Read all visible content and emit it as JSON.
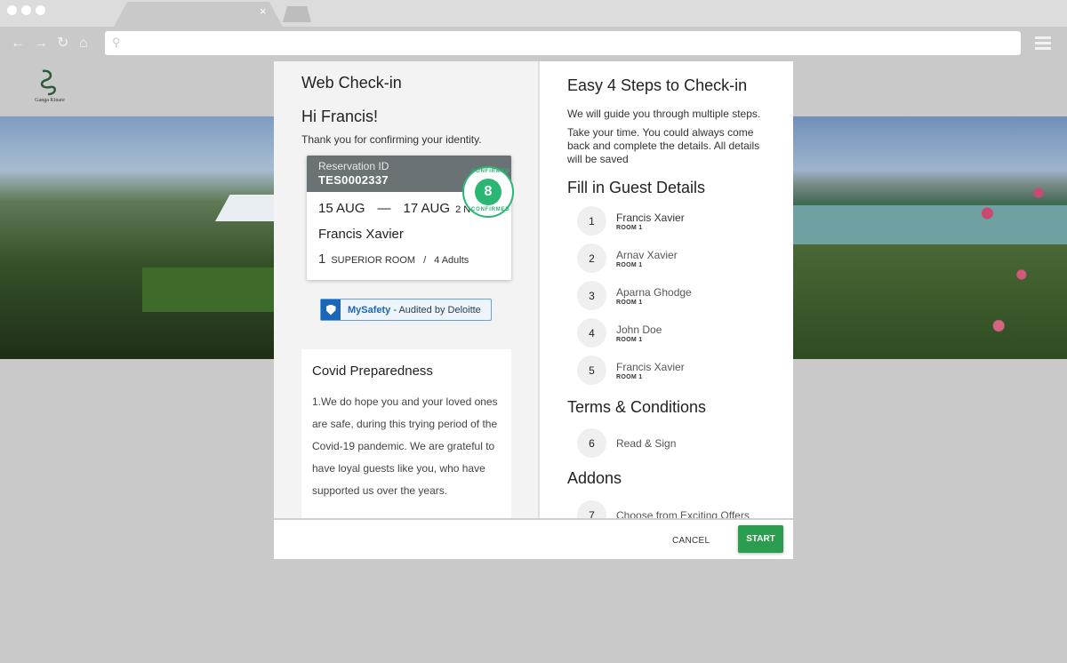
{
  "browser": {
    "tab_close_glyph": "×",
    "back_glyph": "←",
    "forward_glyph": "→",
    "reload_glyph": "↻",
    "home_glyph": "⌂",
    "search_glyph": "⚲",
    "url": ""
  },
  "site": {
    "logo_text": "Ganga Kinare"
  },
  "left": {
    "title": "Web Check-in",
    "greeting": "Hi Francis!",
    "thanks": "Thank you for confirming your identity.",
    "reservation": {
      "id_label": "Reservation ID",
      "id": "TES0002337",
      "check_in": "15 AUG",
      "dash": "—",
      "check_out": "17 AUG",
      "nights": "2 N",
      "guest": "Francis Xavier",
      "room_count": "1",
      "room_type": "SUPERIOR ROOM",
      "sep": "/",
      "guests": "4 Adults",
      "stamp_top": "CONFIRMED",
      "stamp_bottom": "CONFIRMED",
      "stamp_glyph": "8"
    },
    "safety": {
      "brand": "MySafety",
      "text": " - Audited by Deloitte"
    },
    "covid": {
      "title": "Covid Preparedness",
      "body": "1.We do hope you and your loved ones are safe, during this trying period of the Covid-19 pandemic. We are grateful to have loyal guests like you, who have supported us over the years."
    }
  },
  "right": {
    "title": "Easy 4 Steps to Check-in",
    "text1": "We will guide you through multiple steps.",
    "text2": "Take your time. You could always come back and complete the details. All details will be saved",
    "guest_section": "Fill in Guest Details",
    "guests": [
      {
        "num": "1",
        "name": "Francis Xavier",
        "room": "ROOM 1"
      },
      {
        "num": "2",
        "name": "Arnav Xavier",
        "room": "ROOM 1"
      },
      {
        "num": "3",
        "name": "Aparna Ghodge",
        "room": "ROOM 1"
      },
      {
        "num": "4",
        "name": "John Doe",
        "room": "ROOM 1"
      },
      {
        "num": "5",
        "name": "Francis Xavier",
        "room": "ROOM 1"
      }
    ],
    "terms_section": "Terms & Conditions",
    "terms_step": {
      "num": "6",
      "label": "Read & Sign"
    },
    "addons_section": "Addons",
    "addons_step": {
      "num": "7",
      "label": "Choose from Exciting Offers"
    }
  },
  "footer": {
    "cancel": "CANCEL",
    "start": "START"
  },
  "colors": {
    "accent_green": "#2a9d4e",
    "stamp_green": "#2bb673",
    "card_header": "#6b7276"
  }
}
